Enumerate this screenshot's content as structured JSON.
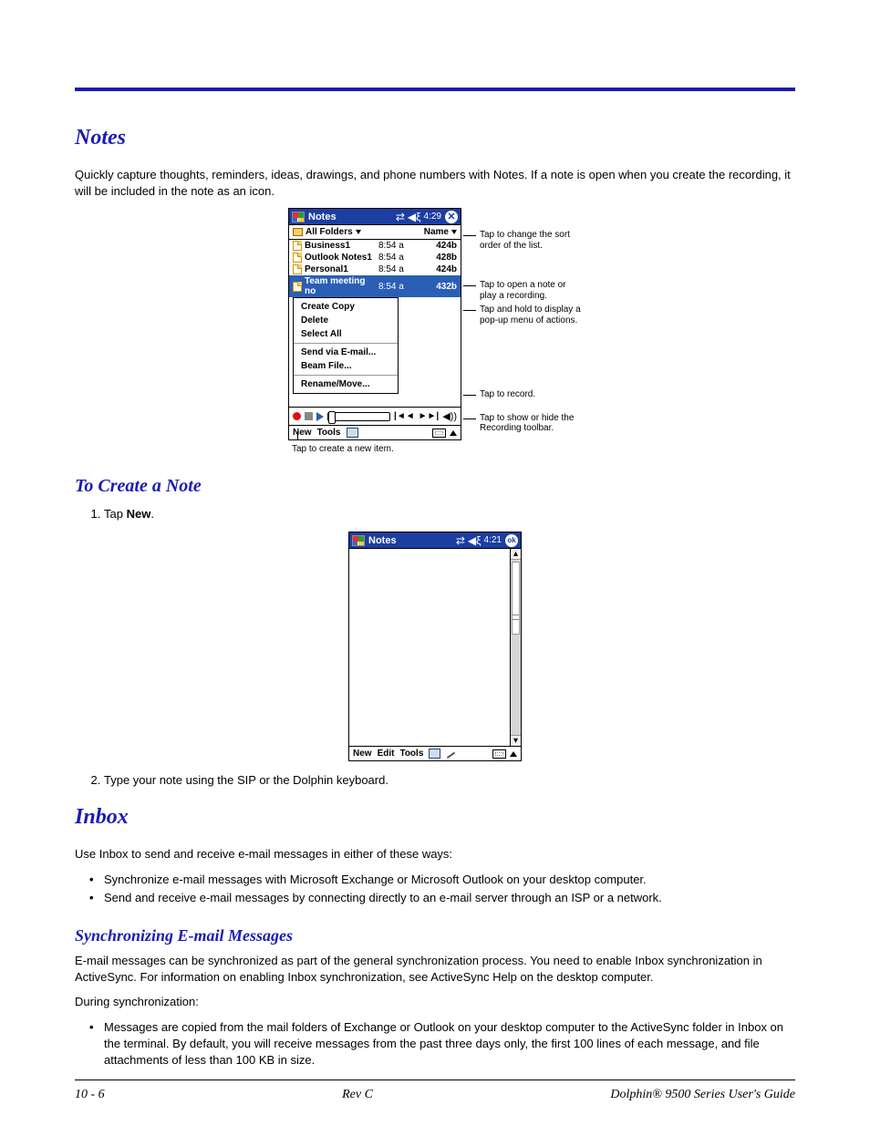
{
  "section_notes_title": "Notes",
  "notes_intro": "Quickly capture thoughts, reminders, ideas, drawings, and phone numbers with Notes. If a note is open when you create the recording, it will be included in the note as an icon.",
  "fig1": {
    "title": "Notes",
    "time": "4:29",
    "folders_label": "All Folders",
    "sort_label": "Name",
    "rows": [
      {
        "name": "Business1",
        "time": "8:54 a",
        "size": "424b"
      },
      {
        "name": "Outlook Notes1",
        "time": "8:54 a",
        "size": "428b"
      },
      {
        "name": "Personal1",
        "time": "8:54 a",
        "size": "424b"
      },
      {
        "name": "Team meeting no",
        "time": "8:54 a",
        "size": "432b"
      }
    ],
    "ctx": [
      "Create Copy",
      "Delete",
      "Select All",
      "Send via E-mail...",
      "Beam File...",
      "Rename/Move..."
    ],
    "menubar": [
      "New",
      "Tools"
    ],
    "tap_create": "Tap to create a new item.",
    "annots": [
      "Tap to change the sort order of the list.",
      "Tap to open a note or play a recording.",
      "Tap and hold to display a pop-up menu of actions.",
      "Tap to record.",
      "Tap to show or hide the Recording toolbar."
    ]
  },
  "h2_create": "To Create a Note",
  "step1_prefix": "Tap ",
  "step1_bold": "New",
  "step1_suffix": ".",
  "fig2": {
    "title": "Notes",
    "time": "4:21",
    "menubar": [
      "New",
      "Edit",
      "Tools"
    ]
  },
  "step2": "Type your note using the SIP or the Dolphin keyboard.",
  "section_inbox_title": "Inbox",
  "inbox_intro": "Use Inbox to send and receive e-mail messages in either of these ways:",
  "inbox_bullets": [
    "Synchronize e-mail messages with Microsoft Exchange or Microsoft Outlook on your desktop computer.",
    "Send and receive e-mail messages by connecting directly to an e-mail server through an ISP or a network."
  ],
  "h3_sync": "Synchronizing E-mail Messages",
  "sync_para": "E-mail messages can be synchronized as part of the general synchronization process. You need to enable Inbox synchronization in ActiveSync. For information on enabling Inbox synchronization, see ActiveSync Help on the desktop computer.",
  "during_sync": "During synchronization:",
  "sync_bullets": [
    "Messages are copied from the mail folders of Exchange or Outlook on your desktop computer to the ActiveSync folder in Inbox on the terminal. By default, you will receive messages from the past three days only, the first 100 lines of each message, and file attachments of less than 100 KB in size."
  ],
  "footer": {
    "left": "10 - 6",
    "center": "Rev C",
    "right": "Dolphin® 9500 Series User's Guide"
  }
}
